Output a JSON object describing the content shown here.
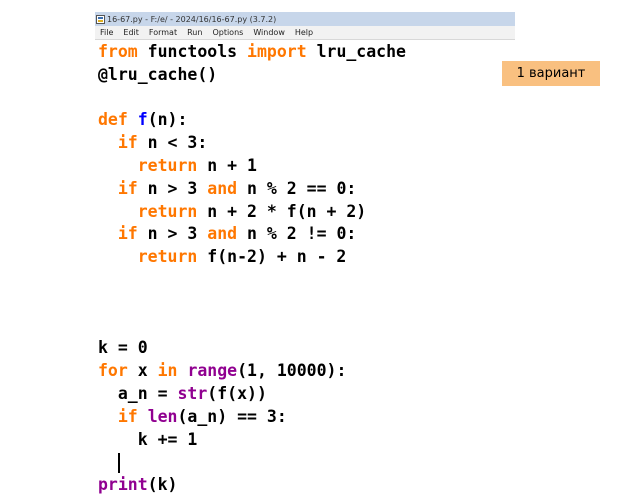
{
  "window": {
    "title": "16-67.py - F:/e/ - 2024/16/16-67.py (3.7.2)",
    "menu": [
      "File",
      "Edit",
      "Format",
      "Run",
      "Options",
      "Window",
      "Help"
    ]
  },
  "badge": {
    "label": "1 вариант"
  },
  "code": {
    "lines": [
      [
        {
          "t": "from",
          "c": "kw"
        },
        {
          "t": " functools "
        },
        {
          "t": "import",
          "c": "kw"
        },
        {
          "t": " lru_cache"
        }
      ],
      [
        {
          "t": "@lru_cache()"
        }
      ],
      [],
      [
        {
          "t": "def",
          "c": "kw"
        },
        {
          "t": " "
        },
        {
          "t": "f",
          "c": "fn"
        },
        {
          "t": "(n):"
        }
      ],
      [
        {
          "t": "  "
        },
        {
          "t": "if",
          "c": "kw"
        },
        {
          "t": " n < 3:"
        }
      ],
      [
        {
          "t": "    "
        },
        {
          "t": "return",
          "c": "kw"
        },
        {
          "t": " n + 1"
        }
      ],
      [
        {
          "t": "  "
        },
        {
          "t": "if",
          "c": "kw"
        },
        {
          "t": " n > 3 "
        },
        {
          "t": "and",
          "c": "kw"
        },
        {
          "t": " n % 2 == 0:"
        }
      ],
      [
        {
          "t": "    "
        },
        {
          "t": "return",
          "c": "kw"
        },
        {
          "t": " n + 2 * f(n + 2)"
        }
      ],
      [
        {
          "t": "  "
        },
        {
          "t": "if",
          "c": "kw"
        },
        {
          "t": " n > 3 "
        },
        {
          "t": "and",
          "c": "kw"
        },
        {
          "t": " n % 2 != 0:"
        }
      ],
      [
        {
          "t": "    "
        },
        {
          "t": "return",
          "c": "kw"
        },
        {
          "t": " f(n-2) + n - 2"
        }
      ],
      [],
      [],
      [],
      [
        {
          "t": "k = 0"
        }
      ],
      [
        {
          "t": "for",
          "c": "kw"
        },
        {
          "t": " x "
        },
        {
          "t": "in",
          "c": "kw"
        },
        {
          "t": " "
        },
        {
          "t": "range",
          "c": "bi"
        },
        {
          "t": "(1, 10000):"
        }
      ],
      [
        {
          "t": "  a_n = "
        },
        {
          "t": "str",
          "c": "bi"
        },
        {
          "t": "(f(x))"
        }
      ],
      [
        {
          "t": "  "
        },
        {
          "t": "if",
          "c": "kw"
        },
        {
          "t": " "
        },
        {
          "t": "len",
          "c": "bi"
        },
        {
          "t": "(a_n) == 3:"
        }
      ],
      [
        {
          "t": "    k += 1"
        }
      ],
      [
        {
          "t": "  "
        },
        {
          "cursor": true
        }
      ],
      [
        {
          "t": "print",
          "c": "bi"
        },
        {
          "t": "(k)"
        }
      ]
    ]
  }
}
